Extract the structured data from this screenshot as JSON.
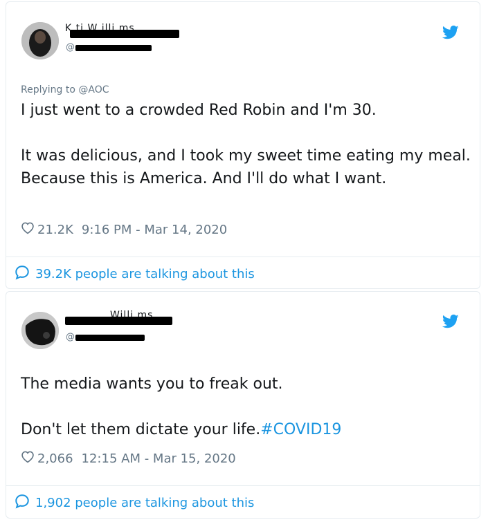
{
  "tweets": [
    {
      "reply_to": "Replying to @AOC",
      "handle_prefix": "@",
      "paragraphs": [
        "I just went to a crowded Red Robin and I'm 30.",
        "It was delicious, and I took my sweet time eating my meal. Because this is America. And I'll do what I want."
      ],
      "likes": "21.2K",
      "timestamp": "9:16 PM - Mar 14, 2020",
      "talking": "39.2K people are talking about this"
    },
    {
      "handle_prefix": "@",
      "paragraphs": [
        "The media wants you to freak out."
      ],
      "text_prefix": "Don't let them dictate your life.",
      "hashtag": "#COVID19",
      "likes": "2,066",
      "timestamp": "12:15 AM - Mar 15, 2020",
      "talking": "1,902 people are talking about this"
    }
  ],
  "colors": {
    "brand_blue": "#1da1f2",
    "link_blue": "#1b95e0",
    "muted_gray": "#657786",
    "text": "#14171a",
    "border": "#e6ecf0"
  },
  "icons": [
    "twitter-bird-icon",
    "heart-icon",
    "speech-bubble-icon"
  ]
}
